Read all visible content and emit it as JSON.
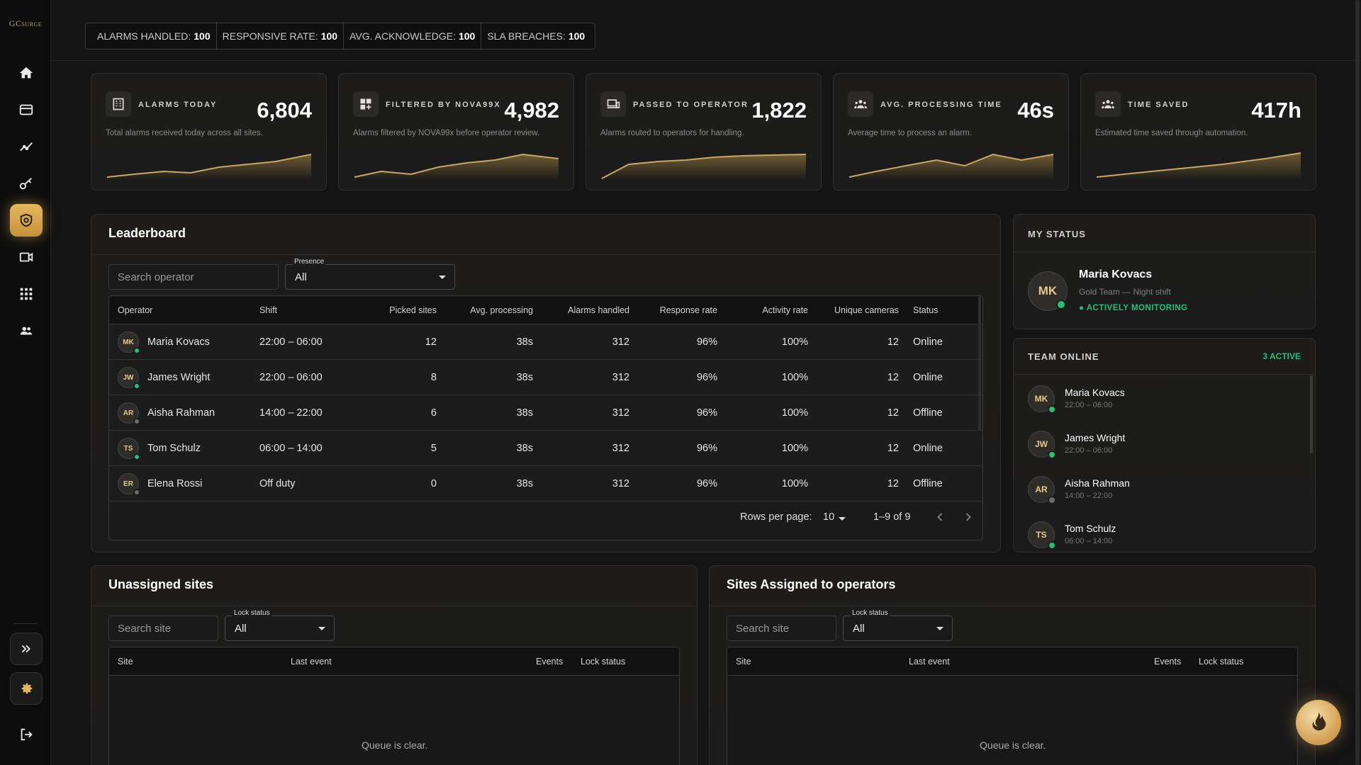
{
  "brand": {
    "logo": "GC",
    "logo_sub": "SURGE"
  },
  "kpis": [
    {
      "label": "ALARMS HANDLED:",
      "value": "100"
    },
    {
      "label": "RESPONSIVE RATE:",
      "value": "100"
    },
    {
      "label": "AVG. ACKNOWLEDGE:",
      "value": "100"
    },
    {
      "label": "SLA BREACHES:",
      "value": "100"
    }
  ],
  "stats": [
    {
      "label": "ALARMS TODAY",
      "value": "6,804",
      "desc": "Total alarms received today across all sites.",
      "icon": "building-icon"
    },
    {
      "label": "FILTERED BY NOVA99X",
      "value": "4,982",
      "desc": "Alarms filtered by NOVA99x before operator review.",
      "icon": "grid-plus-icon"
    },
    {
      "label": "PASSED TO OPERATOR",
      "value": "1,822",
      "desc": "Alarms routed to operators for handling.",
      "icon": "devices-icon"
    },
    {
      "label": "AVG. PROCESSING TIME",
      "value": "46s",
      "desc": "Average time to process an alarm.",
      "icon": "group-icon"
    },
    {
      "label": "TIME SAVED",
      "value": "417h",
      "desc": "Estimated time saved through automation.",
      "icon": "group-icon"
    }
  ],
  "leaderboard": {
    "title": "Leaderboard",
    "search_placeholder": "Search operator",
    "presence_label": "Presence",
    "presence_value": "All",
    "columns": [
      "Operator",
      "Shift",
      "Picked sites",
      "Avg. processing",
      "Alarms handled",
      "Response rate",
      "Activity rate",
      "Unique cameras",
      "Status"
    ],
    "rows": [
      {
        "initials": "MK",
        "name": "Maria Kovacs",
        "shift": "22:00 – 06:00",
        "picked": "12",
        "avg": "38s",
        "handled": "312",
        "response": "96%",
        "activity": "100%",
        "cameras": "12",
        "status": "Online"
      },
      {
        "initials": "JW",
        "name": "James Wright",
        "shift": "22:00 – 06:00",
        "picked": "8",
        "avg": "38s",
        "handled": "312",
        "response": "96%",
        "activity": "100%",
        "cameras": "12",
        "status": "Online"
      },
      {
        "initials": "AR",
        "name": "Aisha Rahman",
        "shift": "14:00 – 22:00",
        "picked": "6",
        "avg": "38s",
        "handled": "312",
        "response": "96%",
        "activity": "100%",
        "cameras": "12",
        "status": "Offline"
      },
      {
        "initials": "TS",
        "name": "Tom Schulz",
        "shift": "06:00 – 14:00",
        "picked": "5",
        "avg": "38s",
        "handled": "312",
        "response": "96%",
        "activity": "100%",
        "cameras": "12",
        "status": "Online"
      },
      {
        "initials": "ER",
        "name": "Elena Rossi",
        "shift": "Off duty",
        "picked": "0",
        "avg": "38s",
        "handled": "312",
        "response": "96%",
        "activity": "100%",
        "cameras": "12",
        "status": "Offline"
      }
    ],
    "rows_per_page_label": "Rows per page:",
    "rows_per_page": "10",
    "range": "1–9 of 9"
  },
  "my_status": {
    "title": "MY STATUS",
    "initials": "MK",
    "name": "Maria Kovacs",
    "team": "Gold Team — Night shift",
    "state": "● ACTIVELY MONITORING"
  },
  "team_online": {
    "title": "TEAM ONLINE",
    "count": "3 ACTIVE",
    "members": [
      {
        "initials": "MK",
        "name": "Maria Kovacs",
        "shift": "22:00 – 06:00",
        "online": true
      },
      {
        "initials": "JW",
        "name": "James Wright",
        "shift": "22:00 – 06:00",
        "online": true
      },
      {
        "initials": "AR",
        "name": "Aisha Rahman",
        "shift": "14:00 – 22:00",
        "online": false
      },
      {
        "initials": "TS",
        "name": "Tom Schulz",
        "shift": "06:00 – 14:00",
        "online": true
      }
    ]
  },
  "unassigned": {
    "title": "Unassigned sites",
    "search_placeholder": "Search site",
    "lock_label": "Lock status",
    "lock_value": "All",
    "columns": [
      "Site",
      "Last event",
      "Events",
      "Lock status"
    ],
    "empty": "Queue is clear."
  },
  "assigned": {
    "title": "Sites Assigned to operators",
    "search_placeholder": "Search site",
    "lock_label": "Lock status",
    "lock_value": "All",
    "columns": [
      "Site",
      "Last event",
      "Events",
      "Lock status"
    ],
    "empty": "Queue is clear."
  },
  "colors": {
    "accent": "#d6a84f",
    "online": "#22c07a",
    "offline": "#6b6b6b"
  }
}
